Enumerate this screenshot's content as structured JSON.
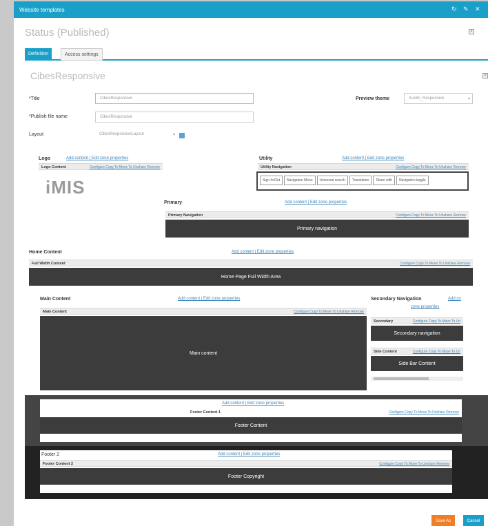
{
  "window": {
    "title": "Website templates"
  },
  "status": "Status (Published)",
  "tabs": {
    "definition": "Definition",
    "access": "Access settings"
  },
  "template_name": "CibesResponsive",
  "form": {
    "title_label": "*Title",
    "title_value": "CibesResponsive",
    "publish_label": "*Publish file name",
    "publish_value": "CibesResponsive",
    "layout_label": "Layout",
    "layout_value": "CibesResponsiveLayout",
    "preview_label": "Preview theme",
    "preview_value": "Austin_Responsive"
  },
  "zone_links": "Add content | Edit zone properties",
  "content_actions": "Configure Copy To Move To Unshare Remove",
  "logo": {
    "name": "Logo",
    "bar_label": "Logo Content",
    "image_text": "iMIS"
  },
  "utility": {
    "name": "Utility",
    "bar_label": "Utility Navigation",
    "items": [
      "Sign In/Out",
      "Navigation Menu",
      "Universal search",
      "Translation",
      "Share with",
      "Navigation toggle"
    ]
  },
  "primary": {
    "name": "Primary",
    "bar_label": "Primary Navigation",
    "content": "Primary navigation"
  },
  "home": {
    "name": "Home Content",
    "bar_label": "Full Width Content",
    "content": "Home Page Full Width Area"
  },
  "main": {
    "name": "Main Content",
    "bar_label": "Main Content",
    "content": "Main content"
  },
  "secondary": {
    "name": "Secondary Navigation",
    "add_link": "Add co",
    "edit_link": "zone properties",
    "bar1_label": "Secondary",
    "bar1_actions": "Configure Copy To Move To Un",
    "content1": "Secondary navigation",
    "bar2_label": "Side Content",
    "bar2_actions": "Configure Copy To Move To Un",
    "content2": "Side Bar Content"
  },
  "footer1": {
    "bar_label": "Footer Content 1",
    "content": "Footer Content"
  },
  "footer2": {
    "name": "Footer 2",
    "bar_label": "Footer Content 2",
    "content": "Footer Copyright"
  },
  "buttons": {
    "save_as": "Save As",
    "cancel": "Cancel"
  },
  "colors": {
    "accent": "#1aa0c8",
    "dark_block": "#3c3c3c",
    "save_as": "#f07e26",
    "cancel": "#1aa0c8"
  }
}
